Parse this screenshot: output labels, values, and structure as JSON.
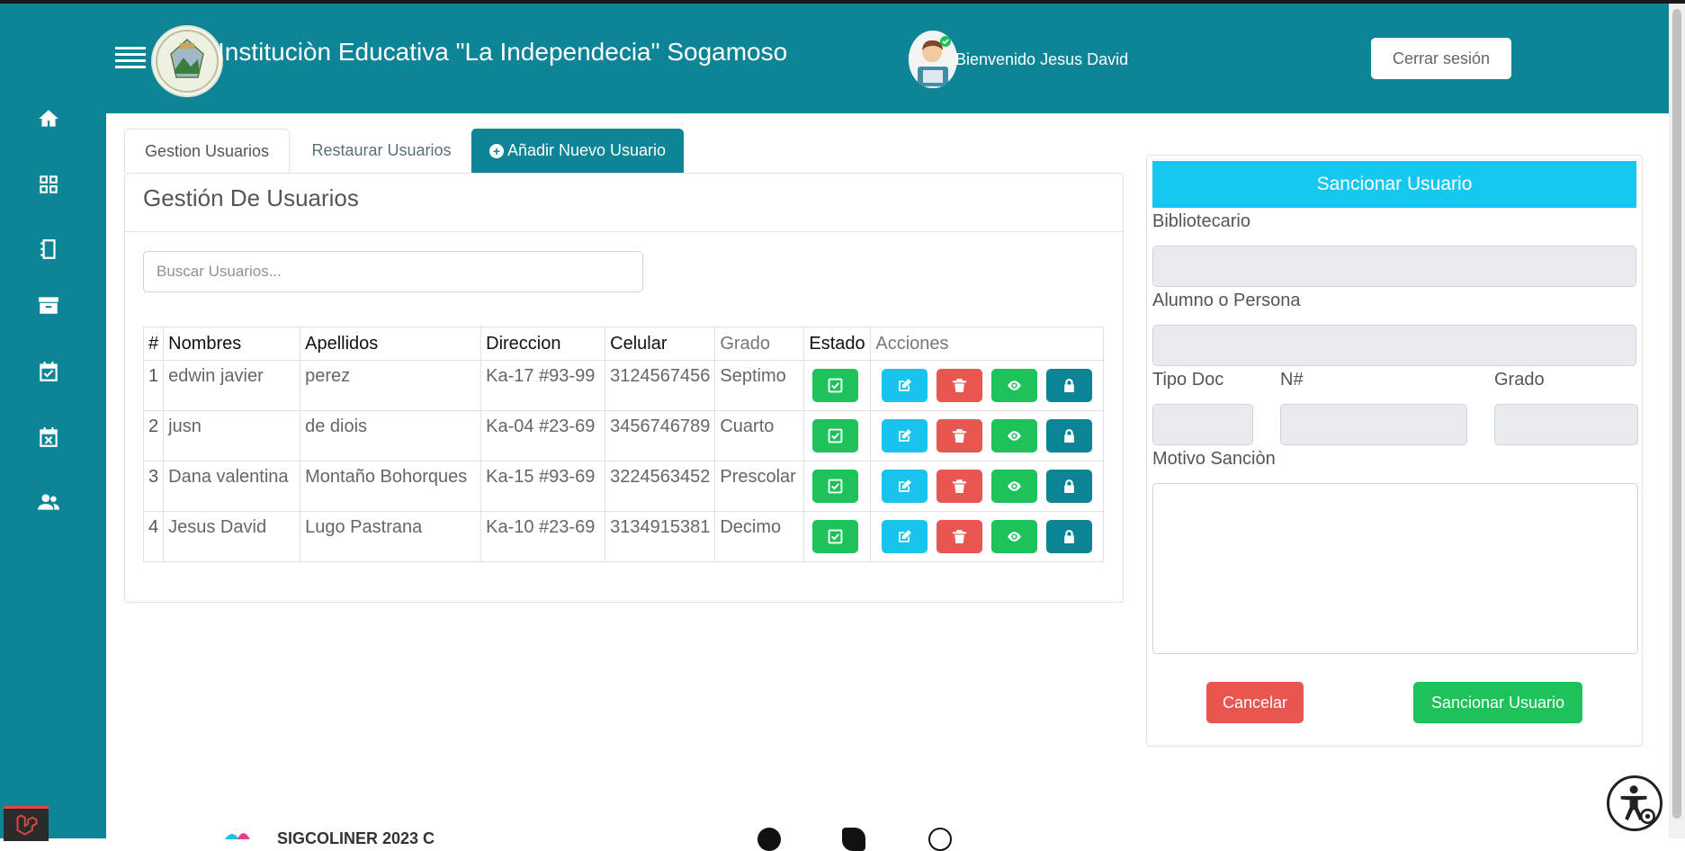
{
  "header": {
    "title": "Instituciòn Educativa \"La Independecia\" Sogamoso",
    "welcome": "Bienvenido Jesus David",
    "logout_label": "Cerrar sesión"
  },
  "sidebar": {
    "items": [
      {
        "icon": "home-icon"
      },
      {
        "icon": "grid-icon"
      },
      {
        "icon": "notebook-icon"
      },
      {
        "icon": "archive-icon"
      },
      {
        "icon": "calendar-check-icon"
      },
      {
        "icon": "calendar-x-icon"
      },
      {
        "icon": "users-icon"
      }
    ]
  },
  "tabs": {
    "manage": "Gestion Usuarios",
    "restore": "Restaurar Usuarios",
    "add": "Añadir Nuevo Usuario"
  },
  "main": {
    "title": "Gestión De Usuarios",
    "search_placeholder": "Buscar Usuarios..."
  },
  "table": {
    "headers": [
      "#",
      "Nombres",
      "Apellidos",
      "Direccion",
      "Celular",
      "Grado",
      "Estado",
      "Acciones"
    ],
    "rows": [
      {
        "n": "1",
        "nombres": "edwin javier",
        "apellidos": "perez",
        "direccion": "Ka-17 #93-99",
        "celular": "3124567456",
        "grado": "Septimo"
      },
      {
        "n": "2",
        "nombres": "jusn",
        "apellidos": "de diois",
        "direccion": "Ka-04 #23-69",
        "celular": "3456746789",
        "grado": "Cuarto"
      },
      {
        "n": "3",
        "nombres": "Dana valentina",
        "apellidos": "Montaño Bohorques",
        "direccion": "Ka-15 #93-69",
        "celular": "3224563452",
        "grado": "Prescolar"
      },
      {
        "n": "4",
        "nombres": "Jesus David",
        "apellidos": "Lugo Pastrana",
        "direccion": "Ka-10 #23-69",
        "celular": "3134915381",
        "grado": "Decimo"
      }
    ]
  },
  "sanction": {
    "title": "Sancionar Usuario",
    "bibliotecario_label": "Bibliotecario",
    "alumno_label": "Alumno o Persona",
    "tipo_doc_label": "Tipo Doc",
    "numero_label": "N#",
    "grado_label": "Grado",
    "motivo_label": "Motivo Sanciòn",
    "cancel_label": "Cancelar",
    "submit_label": "Sancionar Usuario"
  },
  "footer": {
    "text": "SIGCOLINER 2023 C"
  },
  "colors": {
    "primary": "#0e8597",
    "info": "#14c8ef",
    "success": "#1dc35a",
    "danger": "#e9554f"
  }
}
